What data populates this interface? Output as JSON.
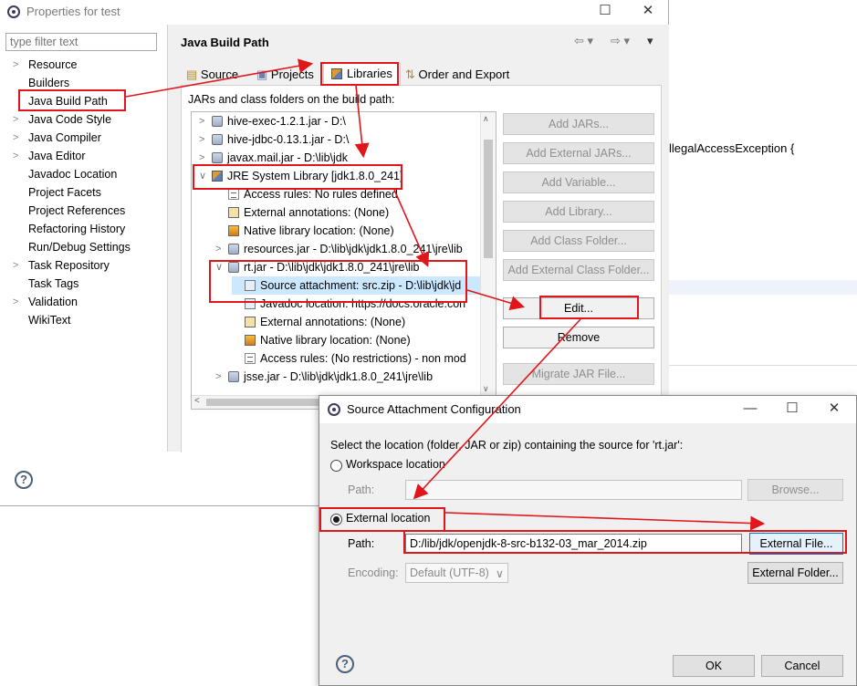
{
  "editor": {
    "code_text": "llegalAccessException {"
  },
  "props_dialog": {
    "title": "Properties for test",
    "filter_placeholder": "type filter text",
    "nav": [
      {
        "label": "Resource",
        "expandable": true
      },
      {
        "label": "Builders",
        "expandable": false
      },
      {
        "label": "Java Build Path",
        "expandable": false,
        "selected": true
      },
      {
        "label": "Java Code Style",
        "expandable": true
      },
      {
        "label": "Java Compiler",
        "expandable": true
      },
      {
        "label": "Java Editor",
        "expandable": true
      },
      {
        "label": "Javadoc Location",
        "expandable": false
      },
      {
        "label": "Project Facets",
        "expandable": false
      },
      {
        "label": "Project References",
        "expandable": false
      },
      {
        "label": "Refactoring History",
        "expandable": false
      },
      {
        "label": "Run/Debug Settings",
        "expandable": false
      },
      {
        "label": "Task Repository",
        "expandable": true
      },
      {
        "label": "Task Tags",
        "expandable": false
      },
      {
        "label": "Validation",
        "expandable": true
      },
      {
        "label": "WikiText",
        "expandable": false
      }
    ],
    "page_title": "Java Build Path",
    "tabs": [
      "Source",
      "Projects",
      "Libraries",
      "Order and Export"
    ],
    "active_tab": "Libraries",
    "build_path_label": "JARs and class folders on the build path:",
    "tree": [
      {
        "label": "hive-exec-1.2.1.jar - D:\\",
        "indent": 0,
        "icon": "jar",
        "twisty": ">"
      },
      {
        "label": "hive-jdbc-0.13.1.jar - D:\\",
        "indent": 0,
        "icon": "jar",
        "twisty": ">"
      },
      {
        "label": "javax.mail.jar - D:\\lib\\jdk",
        "indent": 0,
        "icon": "jar",
        "twisty": ">"
      },
      {
        "label": "JRE System Library [jdk1.8.0_241]",
        "indent": 0,
        "icon": "lib",
        "twisty": "v"
      },
      {
        "label": "Access rules: No rules defined",
        "indent": 1,
        "icon": "rule",
        "twisty": ""
      },
      {
        "label": "External annotations: (None)",
        "indent": 1,
        "icon": "anno",
        "twisty": ""
      },
      {
        "label": "Native library location: (None)",
        "indent": 1,
        "icon": "native",
        "twisty": ""
      },
      {
        "label": "resources.jar - D:\\lib\\jdk\\jdk1.8.0_241\\jre\\lib",
        "indent": 1,
        "icon": "jar",
        "twisty": ">"
      },
      {
        "label": "rt.jar - D:\\lib\\jdk\\jdk1.8.0_241\\jre\\lib",
        "indent": 1,
        "icon": "jar",
        "twisty": "v"
      },
      {
        "label": "Source attachment: src.zip - D:\\lib\\jdk\\jd",
        "indent": 2,
        "icon": "doc",
        "twisty": "",
        "selected": true
      },
      {
        "label": "Javadoc location: https://docs.oracle.con",
        "indent": 2,
        "icon": "doc",
        "twisty": ""
      },
      {
        "label": "External annotations: (None)",
        "indent": 2,
        "icon": "anno",
        "twisty": ""
      },
      {
        "label": "Native library location: (None)",
        "indent": 2,
        "icon": "native",
        "twisty": ""
      },
      {
        "label": "Access rules: (No restrictions) - non mod",
        "indent": 2,
        "icon": "rule",
        "twisty": ""
      },
      {
        "label": "jsse.jar - D:\\lib\\jdk\\jdk1.8.0_241\\jre\\lib",
        "indent": 1,
        "icon": "jar",
        "twisty": ">"
      }
    ],
    "buttons": [
      {
        "label": "Add JARs...",
        "enabled": false
      },
      {
        "label": "Add External JARs...",
        "enabled": false
      },
      {
        "label": "Add Variable...",
        "enabled": false
      },
      {
        "label": "Add Library...",
        "enabled": false
      },
      {
        "label": "Add Class Folder...",
        "enabled": false
      },
      {
        "label": "Add External Class Folder...",
        "enabled": false
      },
      {
        "label": "Edit...",
        "enabled": true
      },
      {
        "label": "Remove",
        "enabled": true
      },
      {
        "label": "Migrate JAR File...",
        "enabled": false
      }
    ]
  },
  "source_dialog": {
    "title": "Source Attachment Configuration",
    "instruction": "Select the location (folder, JAR or zip) containing the source for 'rt.jar':",
    "workspace_label": "Workspace location",
    "workspace_path_label": "Path:",
    "workspace_path_value": "",
    "browse_label": "Browse...",
    "external_label": "External location",
    "external_path_label": "Path:",
    "external_path_value": "D:/lib/jdk/openjdk-8-src-b132-03_mar_2014.zip",
    "external_file_label": "External File...",
    "encoding_label": "Encoding:",
    "encoding_value": "Default (UTF-8)",
    "external_folder_label": "External Folder...",
    "ok_label": "OK",
    "cancel_label": "Cancel",
    "selected_location": "external"
  },
  "colors": {
    "annotation_red": "#e0161b",
    "selection_blue": "#cce8ff"
  }
}
